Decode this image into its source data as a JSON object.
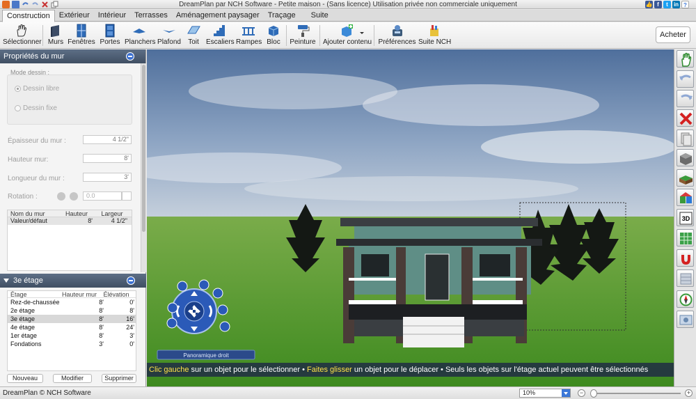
{
  "window": {
    "title": "DreamPlan par NCH Software - Petite maison - (Sans licence) Utilisation privée non commerciale uniquement"
  },
  "tabs": [
    {
      "label": "Construction",
      "active": true
    },
    {
      "label": "Extérieur"
    },
    {
      "label": "Intérieur"
    },
    {
      "label": "Terrasses"
    },
    {
      "label": "Aménagement paysager"
    },
    {
      "label": "Traçage"
    },
    {
      "label": "Suite"
    }
  ],
  "toolbar": {
    "items": [
      {
        "label": "Sélectionner",
        "icon": "hand-icon"
      },
      {
        "label": "Murs",
        "icon": "wall-icon"
      },
      {
        "label": "Fenêtres",
        "icon": "window-icon"
      },
      {
        "label": "Portes",
        "icon": "door-icon"
      },
      {
        "label": "Planchers",
        "icon": "floor-icon"
      },
      {
        "label": "Plafond",
        "icon": "ceiling-icon"
      },
      {
        "label": "Toit",
        "icon": "roof-icon"
      },
      {
        "label": "Escaliers",
        "icon": "stairs-icon"
      },
      {
        "label": "Rampes",
        "icon": "railing-icon"
      },
      {
        "label": "Bloc",
        "icon": "block-icon"
      },
      {
        "label": "Peinture",
        "icon": "paint-roller-icon"
      },
      {
        "label": "Ajouter contenu",
        "icon": "add-content-icon"
      },
      {
        "label": "Préférences",
        "icon": "preferences-icon"
      },
      {
        "label": "Suite NCH",
        "icon": "nch-suite-icon"
      }
    ],
    "buy_label": "Acheter"
  },
  "wall_panel": {
    "title": "Propriétés du mur",
    "mode_label": "Mode dessin :",
    "mode_free": "Dessin libre",
    "mode_fixed": "Dessin fixe",
    "thickness_label": "Épaisseur du mur :",
    "thickness_value": "4 1/2\"",
    "height_label": "Hauteur mur:",
    "height_value": "8'",
    "length_label": "Longueur du mur :",
    "length_value": "3'",
    "rotation_label": "Rotation :",
    "rotation_value": "0.0",
    "table": {
      "headers": [
        "Nom du mur",
        "Hauteur",
        "Largeur"
      ],
      "rows": [
        [
          "Valeur/défaut",
          "8'",
          "4 1/2\""
        ]
      ]
    }
  },
  "floors_panel": {
    "title": "3e étage",
    "headers": [
      "Étage",
      "Hauteur mur",
      "Élévation"
    ],
    "rows": [
      [
        "Rez-de-chaussée",
        "8'",
        "0'"
      ],
      [
        "2e étage",
        "8'",
        "8'"
      ],
      [
        "3e étage",
        "8'",
        "16'"
      ],
      [
        "4e étage",
        "8'",
        "24'"
      ],
      [
        "1er étage",
        "8'",
        "3'"
      ],
      [
        "Fondations",
        "3'",
        "0'"
      ]
    ],
    "selected_row": 2,
    "btn_new": "Nouveau",
    "btn_modify": "Modifier",
    "btn_delete": "Supprimer"
  },
  "viewport": {
    "nav_label": "Panoramique droit",
    "status": {
      "a": "Clic gauche",
      "b": " sur un objet pour le sélectionner • ",
      "c": "Faites glisser",
      "d": " un objet pour le déplacer • Seuls les objets sur l'étage actuel peuvent être sélectionnés"
    }
  },
  "right_toolbar": [
    "hand-icon",
    "undo-icon",
    "redo-icon",
    "delete-icon",
    "copy-icon",
    "box-icon",
    "terrain-icon",
    "materials-icon",
    "3d-view-icon",
    "grid-icon",
    "magnet-icon",
    "layers-icon",
    "compass-icon",
    "screenshot-icon"
  ],
  "statusbar": {
    "copyright": "DreamPlan © NCH Software",
    "zoom": "10%"
  },
  "colors": {
    "accent": "#3c78d8",
    "panel_header": "#4a5a70",
    "sky": "#5f7fa8",
    "grass": "#5a9a34"
  }
}
